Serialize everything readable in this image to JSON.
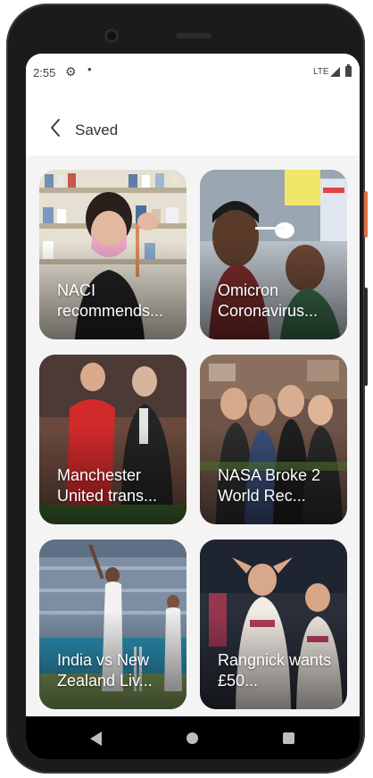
{
  "status_bar": {
    "time": "2:55",
    "settings_icon": "gear-icon",
    "notification_icon": "dot",
    "network": "LTE",
    "signal_icon": "signal-icon",
    "battery_icon": "battery-icon"
  },
  "header": {
    "back_icon": "chevron-left-icon",
    "title": "Saved"
  },
  "saved_articles": [
    {
      "title": "NACI recommends...",
      "image": "pharmacy-worker-mask-photo"
    },
    {
      "title": "Omicron Coronavirus...",
      "image": "nasal-swab-test-photo"
    },
    {
      "title": "Manchester United trans...",
      "image": "footballer-and-coach-photo"
    },
    {
      "title": "NASA Broke 2 World Rec...",
      "image": "astronauts-group-photo"
    },
    {
      "title": "India vs New Zealand Liv...",
      "image": "cricket-match-photo"
    },
    {
      "title": "Rangnick wants £50...",
      "image": "aston-villa-players-photo"
    }
  ],
  "nav_bar": {
    "back_icon": "triangle-back-icon",
    "home_icon": "circle-home-icon",
    "recents_icon": "square-recents-icon"
  },
  "colors": {
    "screen_background": "#f4f4f4",
    "header_background": "#ffffff",
    "nav_background": "#000000"
  }
}
